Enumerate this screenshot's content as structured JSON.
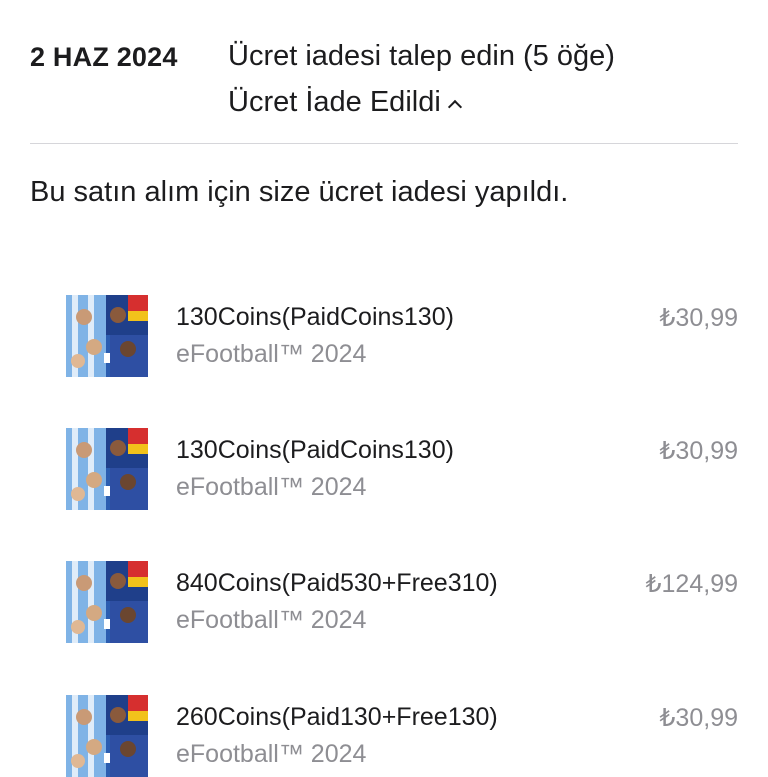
{
  "header": {
    "date": "2 HAZ 2024",
    "request_title": "Ücret iadesi talep edin (5 öğe)",
    "status": "Ücret İade Edildi"
  },
  "message": "Bu satın alım için size ücret iadesi yapıldı.",
  "items": [
    {
      "name": "130Coins(PaidCoins130)",
      "subtitle": "eFootball™ 2024",
      "price": "₺30,99",
      "icon": "efootball-app-icon"
    },
    {
      "name": "130Coins(PaidCoins130)",
      "subtitle": "eFootball™ 2024",
      "price": "₺30,99",
      "icon": "efootball-app-icon"
    },
    {
      "name": "840Coins(Paid530+Free310)",
      "subtitle": "eFootball™ 2024",
      "price": "₺124,99",
      "icon": "efootball-app-icon"
    },
    {
      "name": "260Coins(Paid130+Free130)",
      "subtitle": "eFootball™ 2024",
      "price": "₺30,99",
      "icon": "efootball-app-icon"
    }
  ],
  "colors": {
    "text_primary": "#1c1c1e",
    "text_secondary": "#8e8e93",
    "divider": "#d6d6da"
  }
}
